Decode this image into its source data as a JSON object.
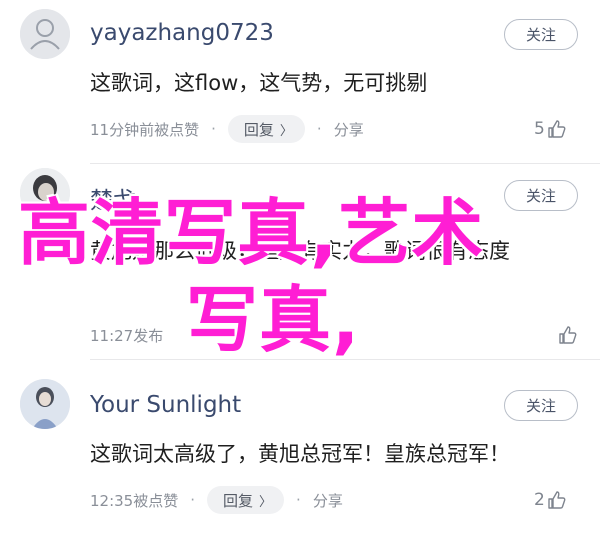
{
  "comments": [
    {
      "username": "yayazhang0723",
      "follow_label": "关注",
      "text": "这歌词，这flow，这气势，无可挑剔",
      "timestamp": "11分钟前被点赞",
      "reply_label": "回复",
      "share_label": "分享",
      "likes": "5"
    },
    {
      "username": "楚戈",
      "follow_label": "关注",
      "text": "黄旭是那么低级，但是有实力，歌词很有态度",
      "timestamp": "11:27发布",
      "likes": ""
    },
    {
      "username": "Your Sunlight",
      "follow_label": "关注",
      "text": "这歌词太高级了，黄旭总冠军！皇族总冠军！",
      "timestamp": "12:35被点赞",
      "reply_label": "回复",
      "share_label": "分享",
      "likes": "2"
    }
  ],
  "overlay": {
    "line1": "高清写真,艺术",
    "line2": "写真,"
  },
  "colors": {
    "overlay_text": "#ff1ed4",
    "username": "#3a4a6e"
  }
}
